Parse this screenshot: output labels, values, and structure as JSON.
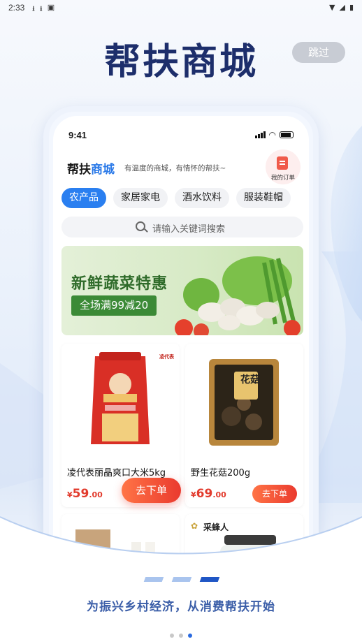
{
  "status_bar": {
    "time": "2:33"
  },
  "splash": {
    "title": "帮扶商城",
    "skip_label": "跳过",
    "tagline": "为振兴乡村经济，从消费帮扶开始"
  },
  "phone": {
    "time": "9:41",
    "shop_name_part1": "帮扶",
    "shop_name_part2": "商城",
    "slogan": "有温度的商城，有情怀的帮扶~",
    "orders_label": "我的订单",
    "tabs": [
      {
        "label": "农产品",
        "active": true
      },
      {
        "label": "家居家电",
        "active": false
      },
      {
        "label": "酒水饮料",
        "active": false
      },
      {
        "label": "服装鞋帽",
        "active": false
      }
    ],
    "search_placeholder": "请输入关键词搜索",
    "banner": {
      "title": "新鲜蔬菜特惠",
      "tag": "全场满99减20"
    },
    "products": [
      {
        "name": "凌代表丽晶爽口大米5kg",
        "currency": "¥",
        "price_int": "59",
        "price_dec": ".00",
        "buy_label": "去下单",
        "brand_badge": "凌代表"
      },
      {
        "name": "野生花菇200g",
        "currency": "¥",
        "price_int": "69",
        "price_dec": ".00",
        "buy_label": "去下单",
        "package_text": "花菇"
      }
    ],
    "more_products_brand": "采蜂人"
  },
  "colors": {
    "accent": "#2a7ff0",
    "price": "#e23b2d",
    "title": "#1d2e6b"
  }
}
